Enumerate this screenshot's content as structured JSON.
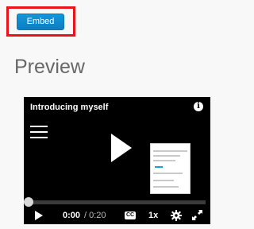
{
  "toolbar": {
    "embed_label": "Embed"
  },
  "preview": {
    "heading": "Preview"
  },
  "player": {
    "video_title": "Introducing myself",
    "info_icon": "info-icon",
    "current_time": "0:00",
    "total_time": "/ 0:20",
    "cc_label": "CC",
    "speed": "1x",
    "progress_fraction": 0.0
  },
  "colors": {
    "embed_button": "#1191d3",
    "highlight_border": "#e8141c",
    "heading": "#686868",
    "player_bg": "#000000"
  }
}
